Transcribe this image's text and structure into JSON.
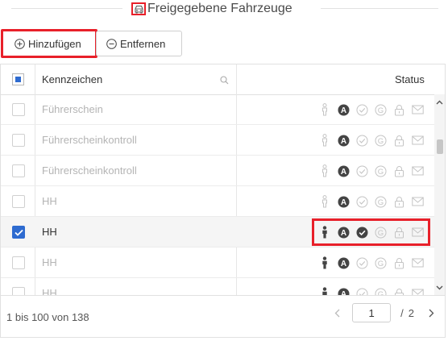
{
  "title": "Freigegebene Fahrzeuge",
  "toolbar": {
    "add_label": "Hinzufügen",
    "remove_label": "Entfernen"
  },
  "grid": {
    "columns": {
      "plate": "Kennzeichen",
      "status": "Status"
    },
    "rows": [
      {
        "label": "Führerschein",
        "checked": false,
        "selected": false,
        "dim": true,
        "status": [
          "person-outline",
          "a-filled",
          "check-light",
          "g-light",
          "lock-light",
          "mail-light"
        ]
      },
      {
        "label": "Führerscheinkontroll",
        "checked": false,
        "selected": false,
        "dim": true,
        "status": [
          "person-outline",
          "a-filled",
          "check-light",
          "g-light",
          "lock-light",
          "mail-light"
        ]
      },
      {
        "label": "Führerscheinkontroll",
        "checked": false,
        "selected": false,
        "dim": true,
        "status": [
          "person-outline",
          "a-filled",
          "check-light",
          "g-light",
          "lock-light",
          "mail-light"
        ]
      },
      {
        "label": "HH",
        "checked": false,
        "selected": false,
        "dim": true,
        "status": [
          "person-outline",
          "a-filled",
          "check-light",
          "g-light",
          "lock-light",
          "mail-light"
        ]
      },
      {
        "label": "HH",
        "checked": true,
        "selected": true,
        "dim": false,
        "status": [
          "person-filled",
          "a-filled",
          "check-filled",
          "g-light",
          "lock-light",
          "mail-light"
        ]
      },
      {
        "label": "HH",
        "checked": false,
        "selected": false,
        "dim": true,
        "status": [
          "person-filled",
          "a-filled",
          "check-light",
          "g-light",
          "lock-light",
          "mail-light"
        ]
      },
      {
        "label": "HH",
        "checked": false,
        "selected": false,
        "dim": true,
        "status": [
          "person-filled",
          "a-filled",
          "check-light",
          "g-light",
          "lock-light",
          "mail-light"
        ]
      }
    ]
  },
  "footer": {
    "range_text": "1 bis 100 von 138",
    "page_current": "1",
    "page_separator": "/",
    "page_total": "2"
  },
  "colors": {
    "accent": "#2e6bd0",
    "highlight": "#e8202a",
    "icon_dark": "#444444",
    "icon_light": "#c4c4c4"
  }
}
